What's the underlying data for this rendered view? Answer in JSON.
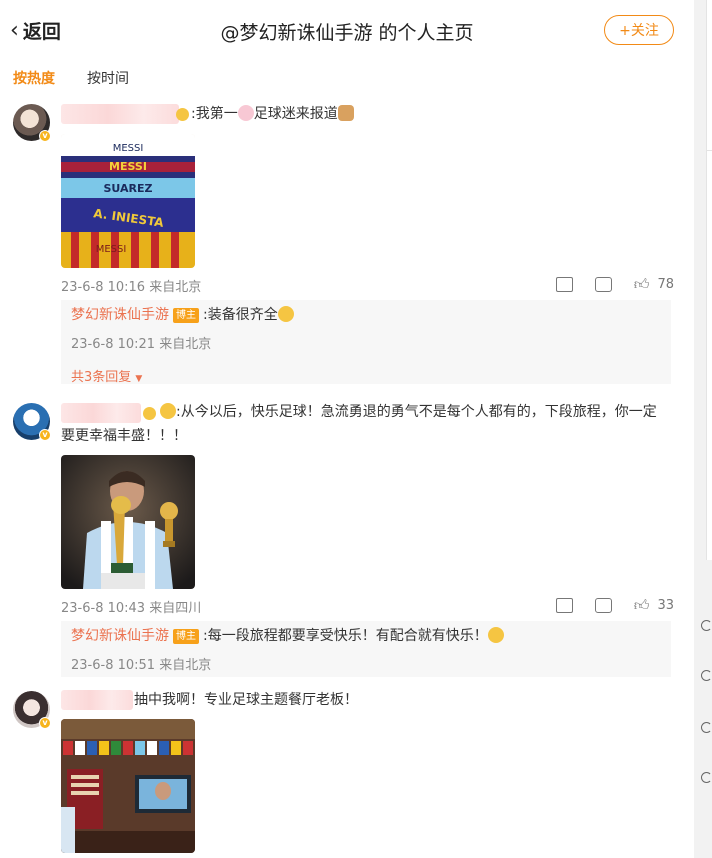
{
  "header": {
    "back_label": "返回",
    "title": "@梦幻新诛仙手游 的个人主页",
    "follow_label": "+关注"
  },
  "sort_tabs": [
    "按热度",
    "按时间"
  ],
  "colors": {
    "accent": "#f28a16",
    "reply_name": "#eb7350",
    "tag_bg": "#f7a11a"
  },
  "comments": [
    {
      "text_a": ":我第一",
      "text_b": "足球迷来报道",
      "time": "23-6-8 10:16 来自北京",
      "likes": "78",
      "reply": {
        "name": "梦幻新诛仙手游",
        "tag": "博主",
        "text": ":装备很齐全",
        "time": "23-6-8 10:21 来自北京"
      },
      "more_replies": "共3条回复",
      "jersey_names": [
        "MESSI",
        "MESSI",
        "SUAREZ",
        "A. INIESTA",
        "MESSI"
      ]
    },
    {
      "text_line1": ":从今以后，快乐足球！急流勇退的勇气不是每个人都有的，下段旅程，你一定",
      "text_line2": "要更幸福丰盛！！！",
      "time": "23-6-8 10:43 来自四川",
      "likes": "33",
      "reply": {
        "name": "梦幻新诛仙手游",
        "tag": "博主",
        "text": ":每一段旅程都要享受快乐！有配合就有快乐！",
        "time": "23-6-8 10:51 来自北京"
      }
    },
    {
      "text": "抽中我啊！专业足球主题餐厅老板！"
    }
  ],
  "icons": [
    "back-chevron-icon",
    "share-icon",
    "comment-icon",
    "like-icon",
    "verified-badge-icon"
  ]
}
